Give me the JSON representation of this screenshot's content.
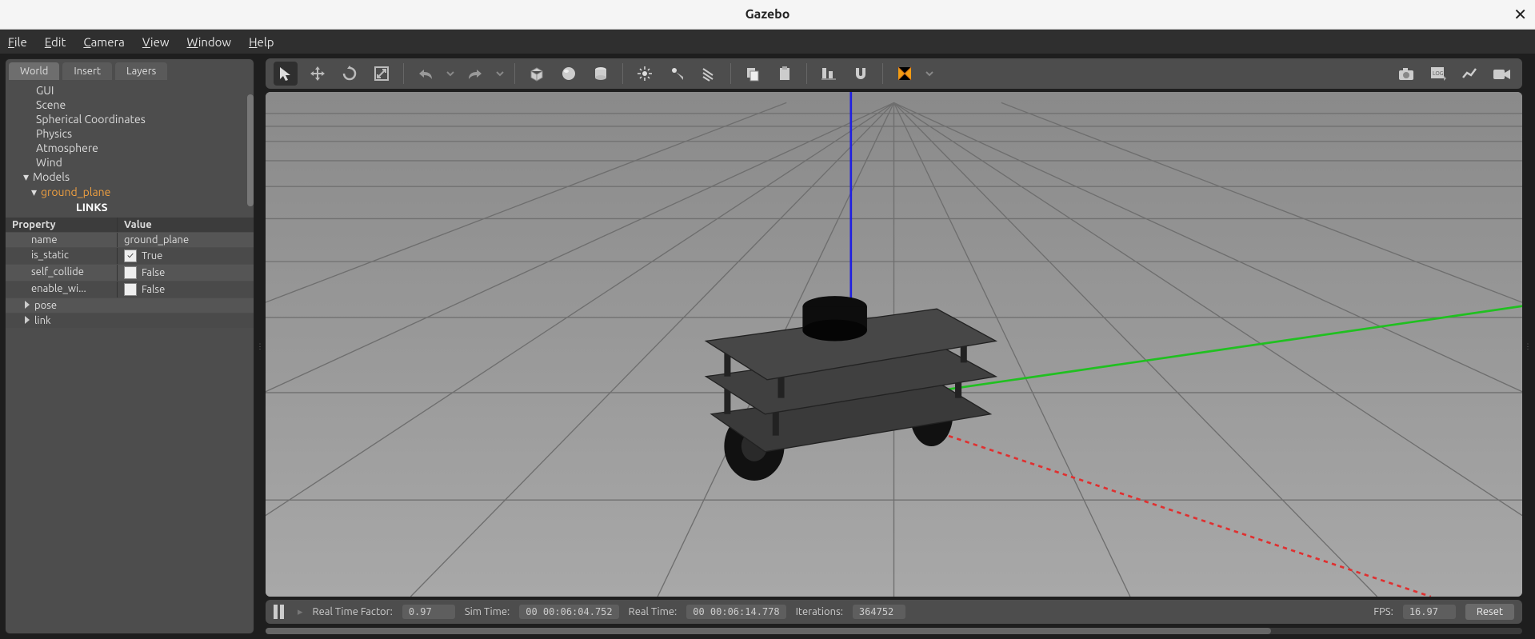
{
  "title": "Gazebo",
  "menu": [
    "File",
    "Edit",
    "Camera",
    "View",
    "Window",
    "Help"
  ],
  "left": {
    "tabs": [
      "World",
      "Insert",
      "Layers"
    ],
    "active_tab": 0,
    "tree": {
      "gui": "GUI",
      "scene": "Scene",
      "spherical": "Spherical Coordinates",
      "physics": "Physics",
      "atmosphere": "Atmosphere",
      "wind": "Wind",
      "models": "Models",
      "ground_plane": "ground_plane",
      "links": "LINKS"
    },
    "prop_header": {
      "property": "Property",
      "value": "Value"
    },
    "props": [
      {
        "k": "name",
        "v": "ground_plane",
        "chk": null
      },
      {
        "k": "is_static",
        "v": "True",
        "chk": true
      },
      {
        "k": "self_collide",
        "v": "False",
        "chk": false
      },
      {
        "k": "enable_wi...",
        "v": "False",
        "chk": false
      }
    ],
    "exp": [
      "pose",
      "link"
    ]
  },
  "status": {
    "rtf_label": "Real Time Factor:",
    "rtf": "0.97",
    "sim_label": "Sim Time:",
    "sim": "00 00:06:04.752",
    "real_label": "Real Time:",
    "real": "00 00:06:14.778",
    "iter_label": "Iterations:",
    "iter": "364752",
    "fps_label": "FPS:",
    "fps": "16.97",
    "reset": "Reset"
  },
  "icons": {
    "select": "select",
    "translate": "translate",
    "rotate": "rotate",
    "scale": "scale",
    "undo": "undo",
    "redo": "redo",
    "box": "box",
    "sphere": "sphere",
    "cylinder": "cylinder",
    "point_light": "point-light",
    "spot_light": "spot-light",
    "dir_light": "directional-light",
    "copy": "copy",
    "paste": "paste",
    "align": "align",
    "snap": "snap",
    "view": "view-mode",
    "screenshot": "screenshot",
    "log": "log",
    "plot": "plot",
    "record": "record"
  }
}
